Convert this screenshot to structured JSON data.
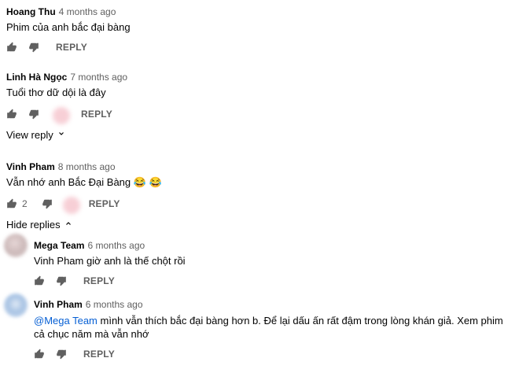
{
  "comments": [
    {
      "author": "Hoang Thu",
      "time": "4 months ago",
      "text": "Phim của anh bắc đại bàng",
      "reply": "REPLY"
    },
    {
      "author": "Linh Hà Ngọc",
      "time": "7 months ago",
      "text": "Tuổi thơ dữ dội là đây",
      "reply": "REPLY",
      "toggle": "View reply"
    },
    {
      "author": "Vinh Pham",
      "time": "8 months ago",
      "text": "Vẫn nhớ anh Bắc Đại Bàng 😂 😂",
      "likes": "2",
      "reply": "REPLY",
      "toggle": "Hide replies"
    }
  ],
  "replies": [
    {
      "author": "Mega Team",
      "time": "6 months ago",
      "text": "Vinh Pham giờ anh là thế chột rồi",
      "reply": "REPLY"
    },
    {
      "author": "Vinh Pham",
      "time": "6 months ago",
      "mention": "@Mega Team",
      "text": " mình vẫn thích bắc đại bàng hơn b. Để lại dấu ấn rất đậm trong lòng khán giả. Xem phim cả chục năm mà vẫn nhớ",
      "reply": "REPLY"
    }
  ],
  "icons": {
    "like": "thumbs-up-icon",
    "dislike": "thumbs-down-icon",
    "expand": "chevron-down-icon",
    "collapse": "chevron-up-icon"
  },
  "colors": {
    "meta": "#606060",
    "link": "#065fd4",
    "text": "#030303"
  }
}
